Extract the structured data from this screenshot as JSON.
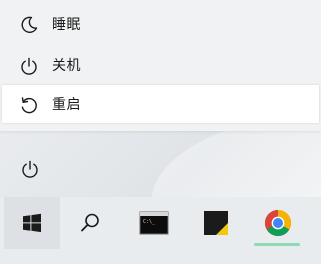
{
  "power_menu": {
    "items": [
      {
        "label": "睡眠",
        "icon": "moon-icon"
      },
      {
        "label": "关机",
        "icon": "power-icon"
      },
      {
        "label": "重启",
        "icon": "restart-icon"
      }
    ],
    "hovered_index": 2
  },
  "start_menu": {
    "power_button_icon": "power-icon"
  },
  "taskbar": {
    "items": [
      {
        "name": "start",
        "icon": "windows-logo-icon"
      },
      {
        "name": "search",
        "icon": "search-icon"
      },
      {
        "name": "terminal",
        "icon": "terminal-icon"
      },
      {
        "name": "sticky-notes",
        "icon": "sticky-notes-icon"
      },
      {
        "name": "chrome",
        "icon": "chrome-icon"
      }
    ],
    "indicator_color": "#8fd9b5"
  },
  "colors": {
    "menu_bg": "#f1f2f3",
    "hover_bg": "#ffffff",
    "text": "#1b1b1b",
    "taskbar_bg": "#e9ecef"
  }
}
